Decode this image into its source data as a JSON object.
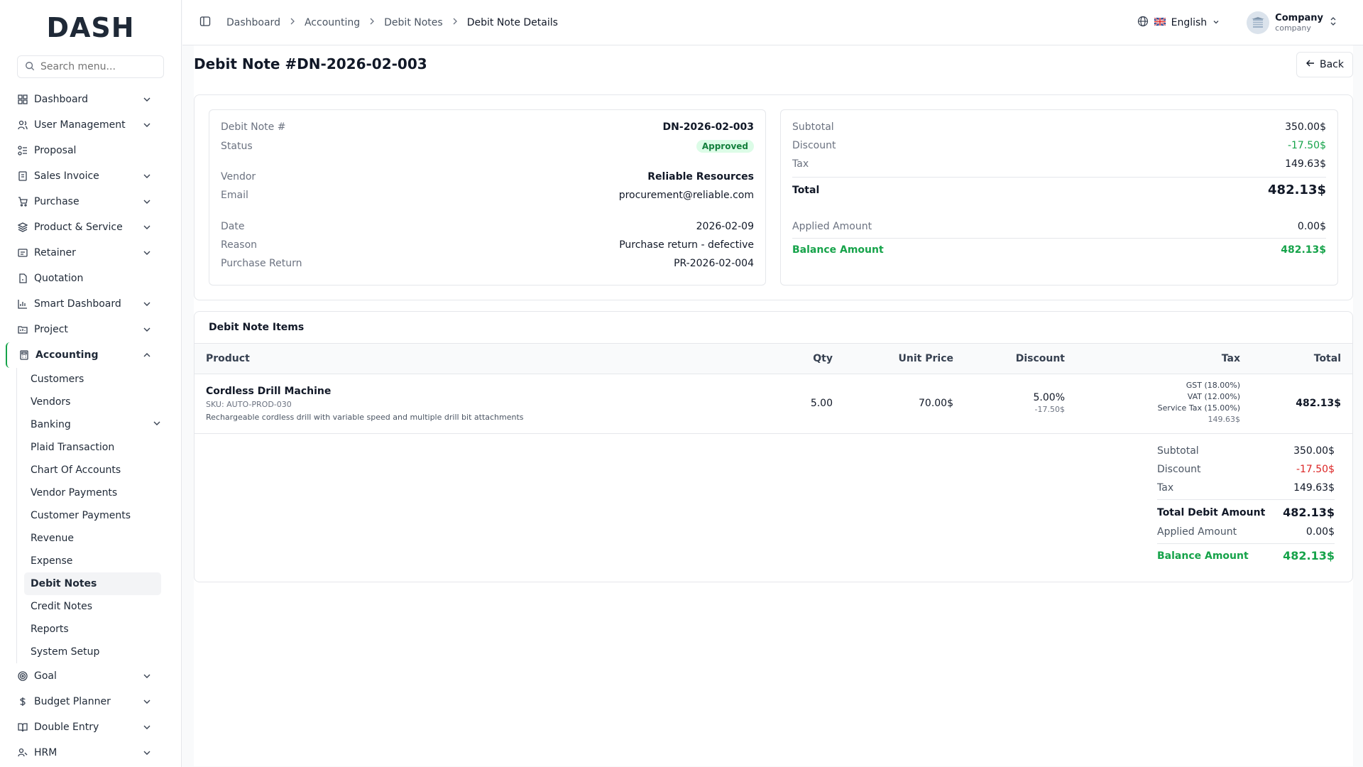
{
  "brand": {
    "logo": "DASH"
  },
  "search": {
    "placeholder": "Search menu..."
  },
  "sidebar": {
    "items": [
      {
        "label": "Dashboard"
      },
      {
        "label": "User Management"
      },
      {
        "label": "Proposal"
      },
      {
        "label": "Sales Invoice"
      },
      {
        "label": "Purchase"
      },
      {
        "label": "Product & Service"
      },
      {
        "label": "Retainer"
      },
      {
        "label": "Quotation"
      },
      {
        "label": "Smart Dashboard"
      },
      {
        "label": "Project"
      },
      {
        "label": "Accounting"
      },
      {
        "label": "Goal"
      },
      {
        "label": "Budget Planner"
      },
      {
        "label": "Double Entry"
      },
      {
        "label": "HRM"
      }
    ],
    "accounting_sub": [
      "Customers",
      "Vendors",
      "Banking",
      "Plaid Transaction",
      "Chart Of Accounts",
      "Vendor Payments",
      "Customer Payments",
      "Revenue",
      "Expense",
      "Debit Notes",
      "Credit Notes",
      "Reports",
      "System Setup"
    ]
  },
  "header": {
    "breadcrumbs": [
      "Dashboard",
      "Accounting",
      "Debit Notes",
      "Debit Note Details"
    ],
    "language": "English",
    "company_name": "Company",
    "company_role": "company"
  },
  "page": {
    "title": "Debit Note #DN-2026-02-003",
    "back_label": "Back"
  },
  "details": {
    "number_label": "Debit Note #",
    "number": "DN-2026-02-003",
    "status_label": "Status",
    "status": "Approved",
    "vendor_label": "Vendor",
    "vendor": "Reliable Resources",
    "email_label": "Email",
    "email": "procurement@reliable.com",
    "date_label": "Date",
    "date": "2026-02-09",
    "reason_label": "Reason",
    "reason": "Purchase return - defective",
    "return_label": "Purchase Return",
    "return": "PR-2026-02-004"
  },
  "summary": {
    "subtotal_label": "Subtotal",
    "subtotal": "350.00$",
    "discount_label": "Discount",
    "discount": "-17.50$",
    "tax_label": "Tax",
    "tax": "149.63$",
    "total_label": "Total",
    "total": "482.13$",
    "applied_label": "Applied Amount",
    "applied": "0.00$",
    "balance_label": "Balance Amount",
    "balance": "482.13$"
  },
  "items": {
    "title": "Debit Note Items",
    "columns": [
      "Product",
      "Qty",
      "Unit Price",
      "Discount",
      "Tax",
      "Total"
    ],
    "rows": [
      {
        "name": "Cordless Drill Machine",
        "sku": "SKU: AUTO-PROD-030",
        "description": "Rechargeable cordless drill with variable speed and multiple drill bit attachments",
        "qty": "5.00",
        "unit_price": "70.00$",
        "discount_pct": "5.00%",
        "discount_amt": "-17.50$",
        "tax_lines": [
          "GST (18.00%)",
          "VAT (12.00%)",
          "Service Tax (15.00%)"
        ],
        "tax_total": "149.63$",
        "total": "482.13$"
      }
    ],
    "totals": {
      "subtotal_label": "Subtotal",
      "subtotal": "350.00$",
      "discount_label": "Discount",
      "discount": "-17.50$",
      "tax_label": "Tax",
      "tax": "149.63$",
      "total_label": "Total Debit Amount",
      "total": "482.13$",
      "applied_label": "Applied Amount",
      "applied": "0.00$",
      "balance_label": "Balance Amount",
      "balance": "482.13$"
    }
  }
}
